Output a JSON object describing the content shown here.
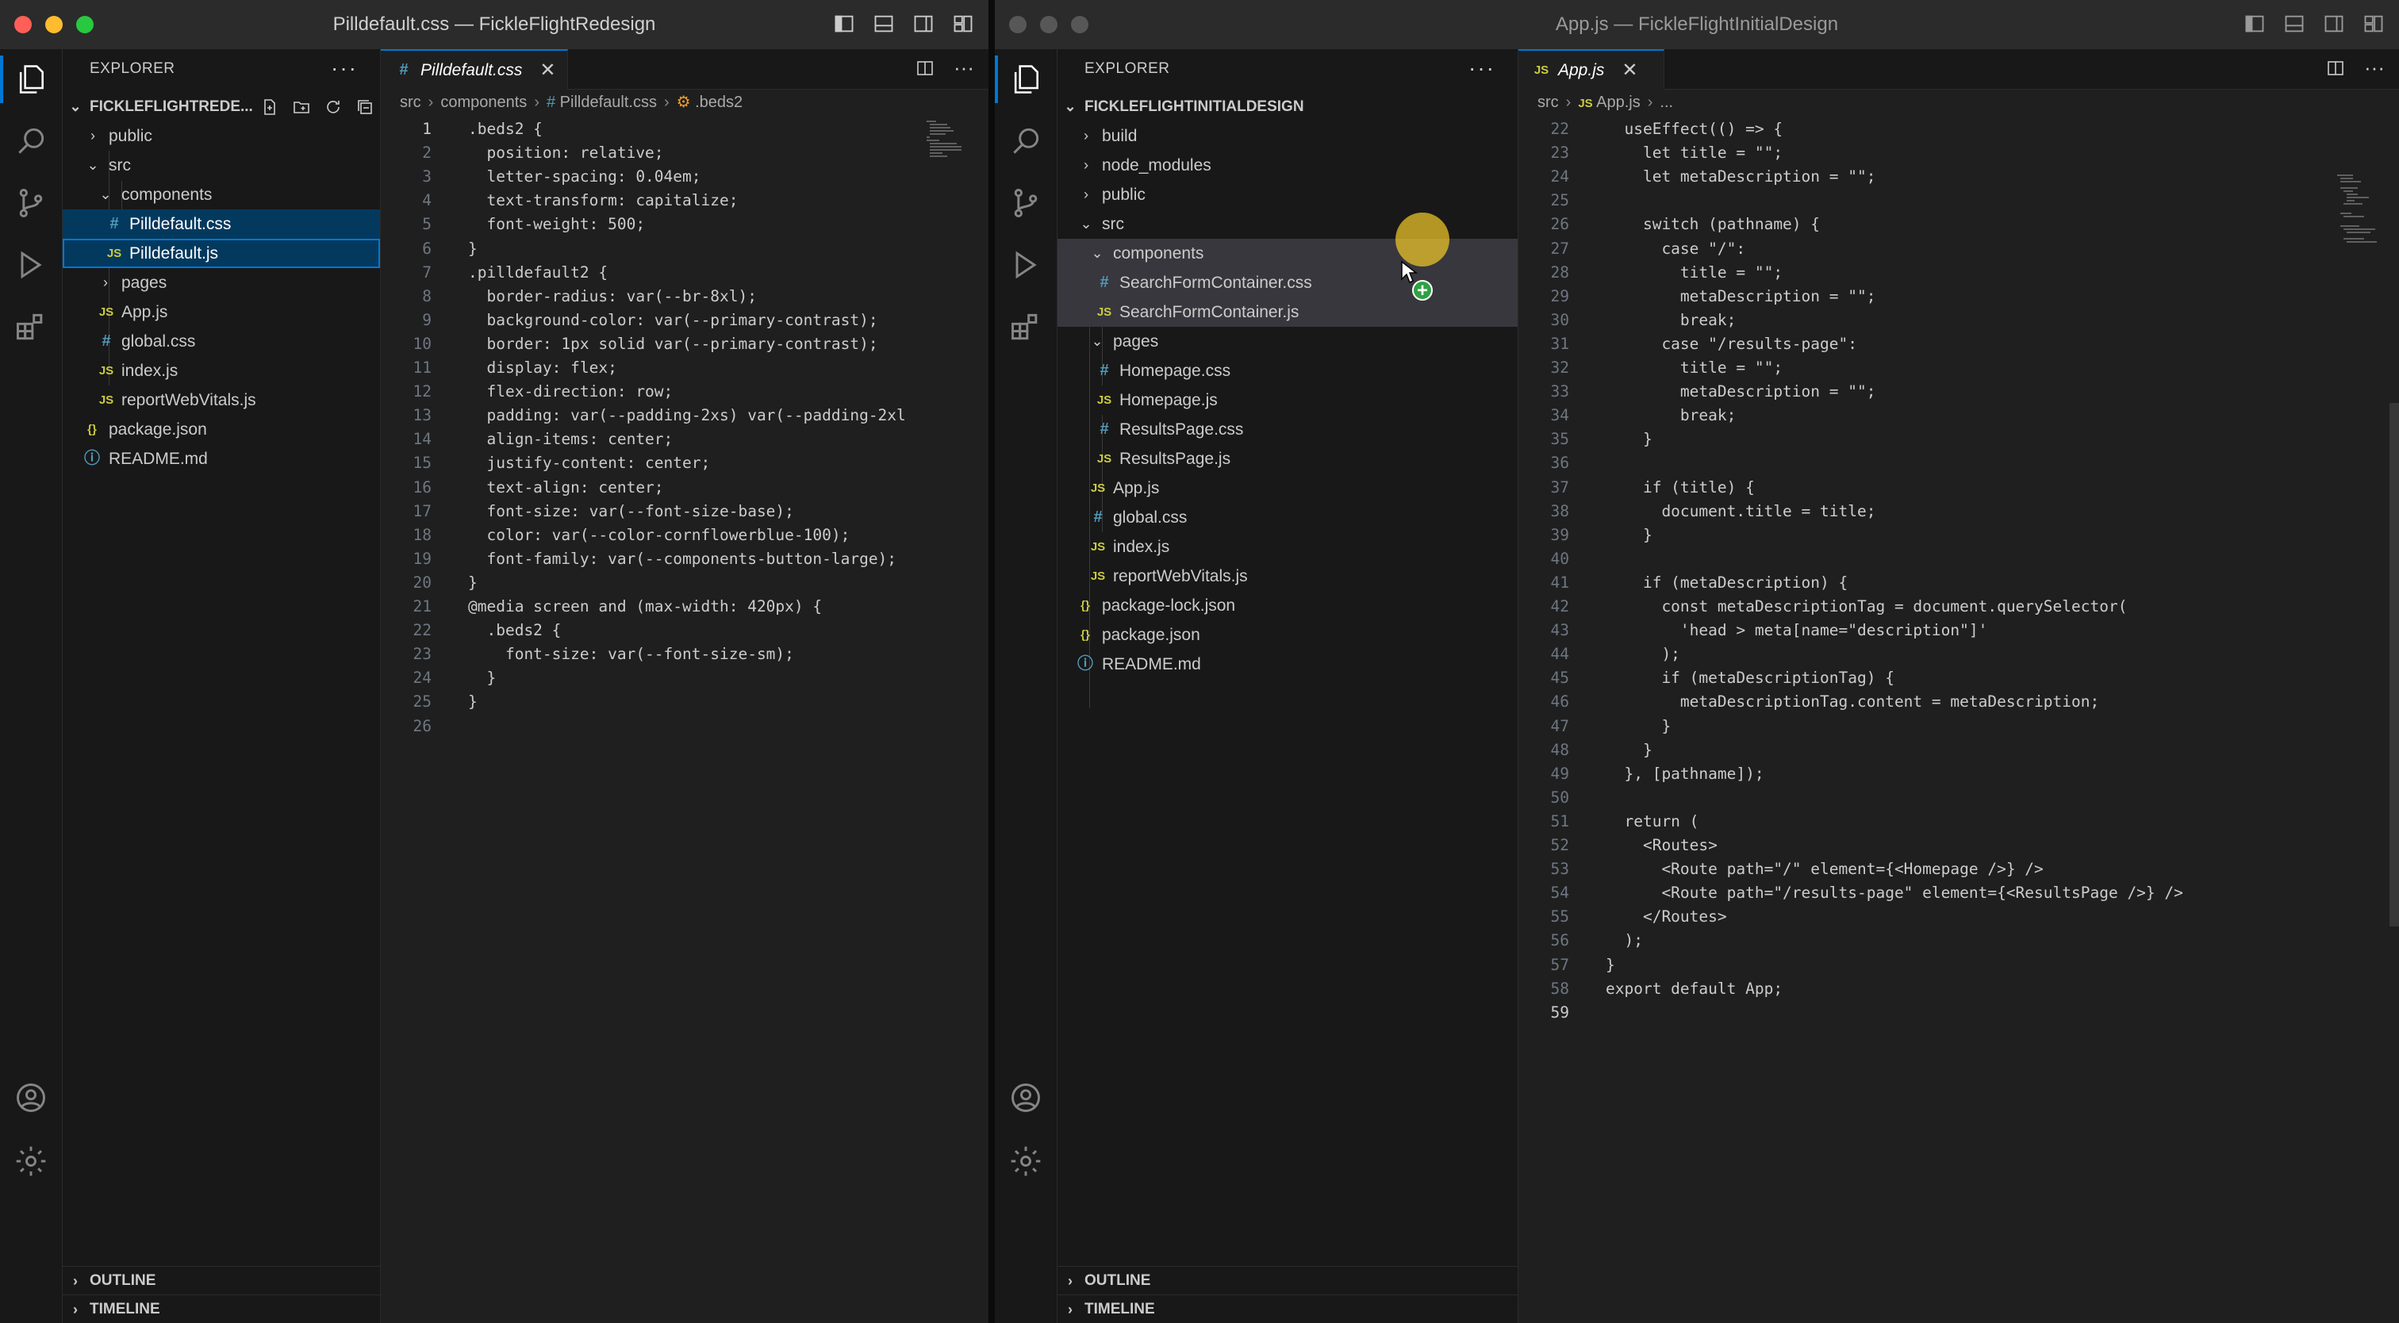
{
  "left_window": {
    "title": "Pilldefault.css — FickleFlightRedesign",
    "explorer": {
      "header": "EXPLORER",
      "more": "···",
      "root": "FICKLEFLIGHTREDE...",
      "items": [
        {
          "label": "public",
          "type": "folder",
          "state": "collapsed"
        },
        {
          "label": "src",
          "type": "folder",
          "state": "expanded"
        },
        {
          "label": "components",
          "type": "folder",
          "state": "expanded"
        },
        {
          "label": "Pilldefault.css",
          "type": "css"
        },
        {
          "label": "Pilldefault.js",
          "type": "js"
        },
        {
          "label": "pages",
          "type": "folder",
          "state": "collapsed"
        },
        {
          "label": "App.js",
          "type": "js"
        },
        {
          "label": "global.css",
          "type": "css"
        },
        {
          "label": "index.js",
          "type": "js"
        },
        {
          "label": "reportWebVitals.js",
          "type": "js"
        },
        {
          "label": "package.json",
          "type": "json"
        },
        {
          "label": "README.md",
          "type": "info"
        }
      ],
      "outline": "OUTLINE",
      "timeline": "TIMELINE"
    },
    "tab": {
      "label": "Pilldefault.css",
      "icon": "#",
      "close": "✕"
    },
    "breadcrumb": {
      "a": "src",
      "b": "components",
      "c": "Pilldefault.css",
      "d": ".beds2"
    },
    "code": [
      {
        "n": "1",
        "t": ".beds2 {"
      },
      {
        "n": "2",
        "t": "  position: relative;"
      },
      {
        "n": "3",
        "t": "  letter-spacing: 0.04em;"
      },
      {
        "n": "4",
        "t": "  text-transform: capitalize;"
      },
      {
        "n": "5",
        "t": "  font-weight: 500;"
      },
      {
        "n": "6",
        "t": "}"
      },
      {
        "n": "7",
        "t": ".pilldefault2 {"
      },
      {
        "n": "8",
        "t": "  border-radius: var(--br-8xl);"
      },
      {
        "n": "9",
        "t": "  background-color: var(--primary-contrast);"
      },
      {
        "n": "10",
        "t": "  border: 1px solid var(--primary-contrast);"
      },
      {
        "n": "11",
        "t": "  display: flex;"
      },
      {
        "n": "12",
        "t": "  flex-direction: row;"
      },
      {
        "n": "13",
        "t": "  padding: var(--padding-2xs) var(--padding-2xl"
      },
      {
        "n": "14",
        "t": "  align-items: center;"
      },
      {
        "n": "15",
        "t": "  justify-content: center;"
      },
      {
        "n": "16",
        "t": "  text-align: center;"
      },
      {
        "n": "17",
        "t": "  font-size: var(--font-size-base);"
      },
      {
        "n": "18",
        "t": "  color: var(--color-cornflowerblue-100);"
      },
      {
        "n": "19",
        "t": "  font-family: var(--components-button-large);"
      },
      {
        "n": "20",
        "t": "}"
      },
      {
        "n": "21",
        "t": "@media screen and (max-width: 420px) {"
      },
      {
        "n": "22",
        "t": "  .beds2 {"
      },
      {
        "n": "23",
        "t": "    font-size: var(--font-size-sm);"
      },
      {
        "n": "24",
        "t": "  }"
      },
      {
        "n": "25",
        "t": "}"
      },
      {
        "n": "26",
        "t": ""
      }
    ]
  },
  "right_window": {
    "title": "App.js — FickleFlightInitialDesign",
    "explorer": {
      "header": "EXPLORER",
      "more": "···",
      "root": "FICKLEFLIGHTINITIALDESIGN",
      "items": [
        {
          "label": "build",
          "type": "folder",
          "state": "collapsed"
        },
        {
          "label": "node_modules",
          "type": "folder",
          "state": "collapsed"
        },
        {
          "label": "public",
          "type": "folder",
          "state": "collapsed"
        },
        {
          "label": "src",
          "type": "folder",
          "state": "expanded"
        },
        {
          "label": "components",
          "type": "folder",
          "state": "expanded"
        },
        {
          "label": "SearchFormContainer.css",
          "type": "css"
        },
        {
          "label": "SearchFormContainer.js",
          "type": "js"
        },
        {
          "label": "pages",
          "type": "folder",
          "state": "expanded"
        },
        {
          "label": "Homepage.css",
          "type": "css"
        },
        {
          "label": "Homepage.js",
          "type": "js"
        },
        {
          "label": "ResultsPage.css",
          "type": "css"
        },
        {
          "label": "ResultsPage.js",
          "type": "js"
        },
        {
          "label": "App.js",
          "type": "js"
        },
        {
          "label": "global.css",
          "type": "css"
        },
        {
          "label": "index.js",
          "type": "js"
        },
        {
          "label": "reportWebVitals.js",
          "type": "js"
        },
        {
          "label": "package-lock.json",
          "type": "json"
        },
        {
          "label": "package.json",
          "type": "json"
        },
        {
          "label": "README.md",
          "type": "info"
        }
      ],
      "outline": "OUTLINE",
      "timeline": "TIMELINE"
    },
    "tab": {
      "label": "App.js",
      "icon": "JS",
      "close": "✕"
    },
    "breadcrumb": {
      "a": "src",
      "b": "App.js",
      "c": "..."
    },
    "code": [
      {
        "n": "22",
        "t": "  useEffect(() => {"
      },
      {
        "n": "23",
        "t": "    let title = \"\";"
      },
      {
        "n": "24",
        "t": "    let metaDescription = \"\";"
      },
      {
        "n": "25",
        "t": ""
      },
      {
        "n": "26",
        "t": "    switch (pathname) {"
      },
      {
        "n": "27",
        "t": "      case \"/\":"
      },
      {
        "n": "28",
        "t": "        title = \"\";"
      },
      {
        "n": "29",
        "t": "        metaDescription = \"\";"
      },
      {
        "n": "30",
        "t": "        break;"
      },
      {
        "n": "31",
        "t": "      case \"/results-page\":"
      },
      {
        "n": "32",
        "t": "        title = \"\";"
      },
      {
        "n": "33",
        "t": "        metaDescription = \"\";"
      },
      {
        "n": "34",
        "t": "        break;"
      },
      {
        "n": "35",
        "t": "    }"
      },
      {
        "n": "36",
        "t": ""
      },
      {
        "n": "37",
        "t": "    if (title) {"
      },
      {
        "n": "38",
        "t": "      document.title = title;"
      },
      {
        "n": "39",
        "t": "    }"
      },
      {
        "n": "40",
        "t": ""
      },
      {
        "n": "41",
        "t": "    if (metaDescription) {"
      },
      {
        "n": "42",
        "t": "      const metaDescriptionTag = document.querySelector("
      },
      {
        "n": "43",
        "t": "        'head > meta[name=\"description\"]'"
      },
      {
        "n": "44",
        "t": "      );"
      },
      {
        "n": "45",
        "t": "      if (metaDescriptionTag) {"
      },
      {
        "n": "46",
        "t": "        metaDescriptionTag.content = metaDescription;"
      },
      {
        "n": "47",
        "t": "      }"
      },
      {
        "n": "48",
        "t": "    }"
      },
      {
        "n": "49",
        "t": "  }, [pathname]);"
      },
      {
        "n": "50",
        "t": ""
      },
      {
        "n": "51",
        "t": "  return ("
      },
      {
        "n": "52",
        "t": "    <Routes>"
      },
      {
        "n": "53",
        "t": "      <Route path=\"/\" element={<Homepage />} />"
      },
      {
        "n": "54",
        "t": "      <Route path=\"/results-page\" element={<ResultsPage />} />"
      },
      {
        "n": "55",
        "t": "    </Routes>"
      },
      {
        "n": "56",
        "t": "  );"
      },
      {
        "n": "57",
        "t": "}"
      },
      {
        "n": "58",
        "t": "export default App;"
      },
      {
        "n": "59",
        "t": ""
      }
    ]
  },
  "colors": {
    "accent": "#0078d4",
    "selection": "#04395e",
    "css_icon": "#519aba",
    "js_icon": "#cbcb41",
    "cursor_highlight": "#f0c828",
    "drag_plus": "#2ea043"
  },
  "icons": [
    "files-icon",
    "search-icon",
    "source-control-icon",
    "run-debug-icon",
    "extensions-icon",
    "account-icon",
    "settings-gear-icon"
  ]
}
